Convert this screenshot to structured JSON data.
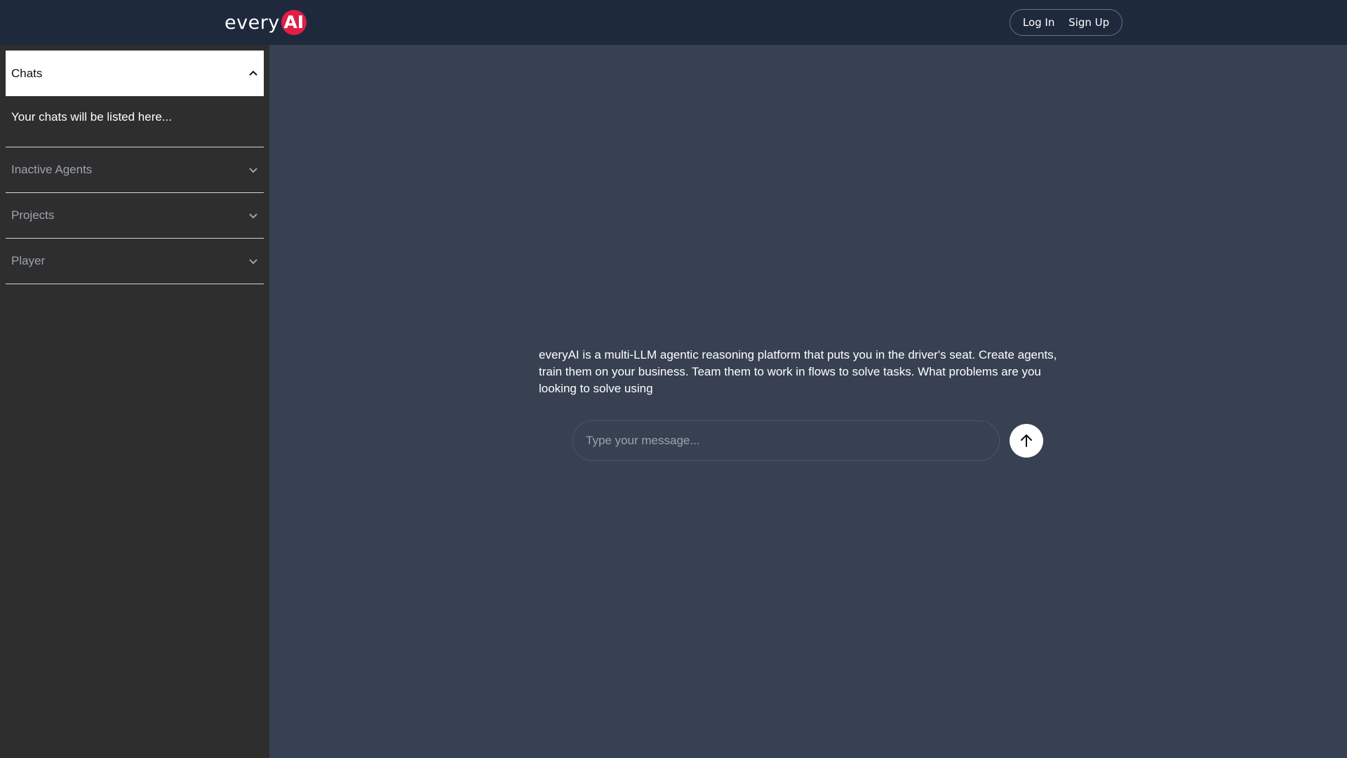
{
  "header": {
    "logo_text": "every",
    "logo_badge": "AI",
    "login_label": "Log In",
    "signup_label": "Sign Up"
  },
  "sidebar": {
    "chats_label": "Chats",
    "chats_empty": "Your chats will be listed here...",
    "sections": [
      {
        "label": "Inactive Agents"
      },
      {
        "label": "Projects"
      },
      {
        "label": "Player"
      }
    ]
  },
  "main": {
    "intro": "everyAI is a multi-LLM agentic reasoning platform that puts you in the driver's seat. Create agents, train them on your business. Team them to work in flows to solve tasks. What problems are you looking to solve using",
    "input_placeholder": "Type your message..."
  },
  "colors": {
    "header_bg": "#1e293b",
    "sidebar_bg": "#2e2e2e",
    "main_bg": "#374152",
    "brand_accent": "#e11d48"
  },
  "icons": {
    "chats_toggle": "chevron-up-icon",
    "section_toggle": "chevron-down-icon",
    "send": "arrow-up-icon"
  }
}
